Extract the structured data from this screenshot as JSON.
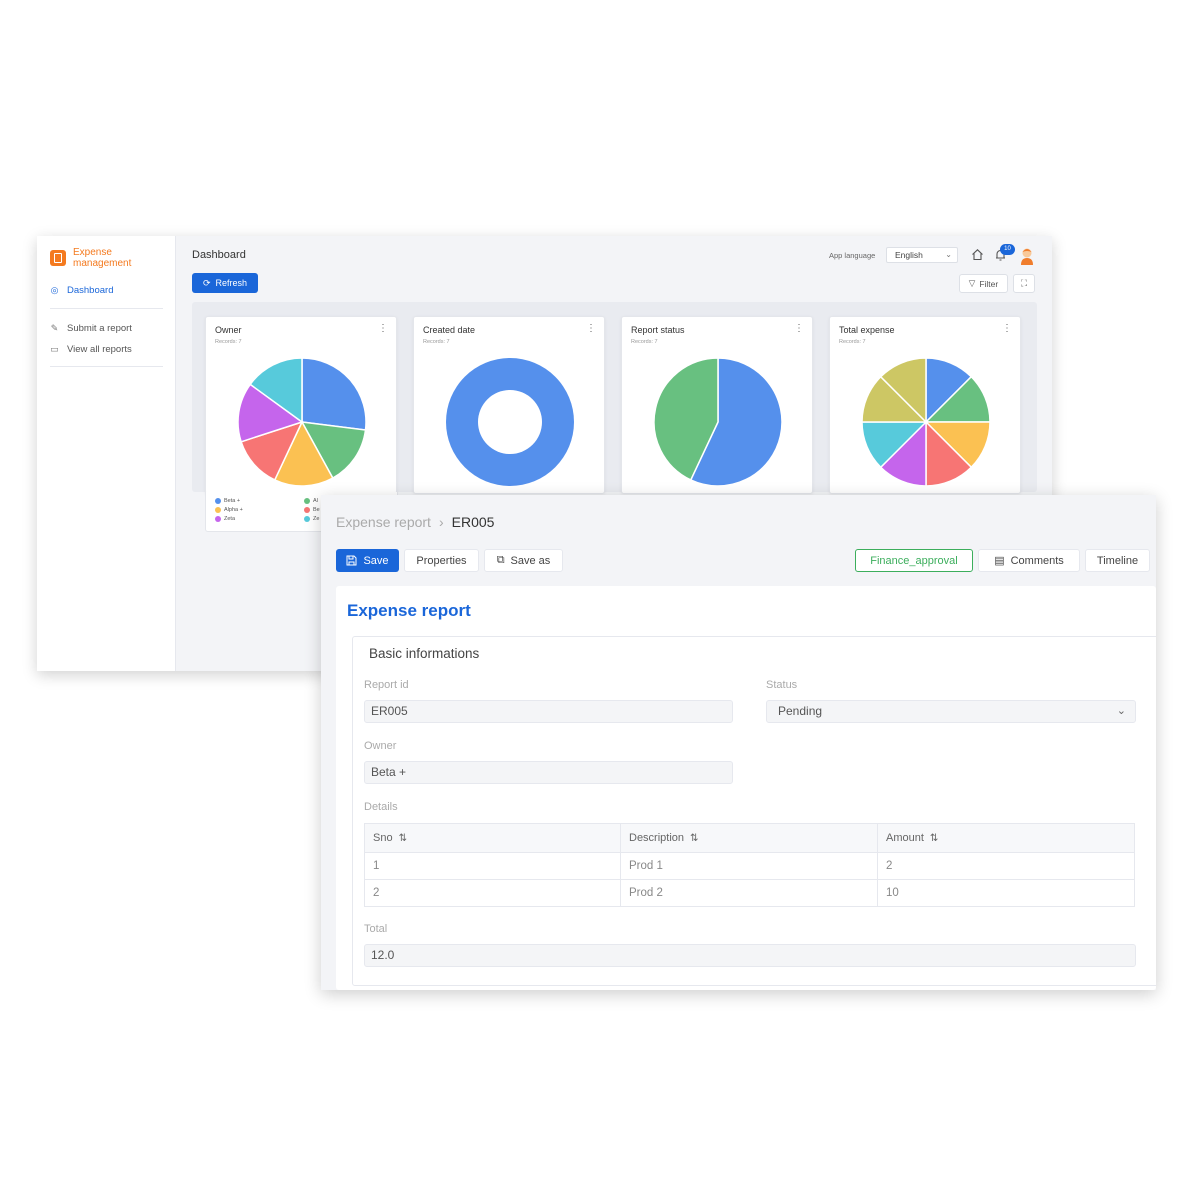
{
  "dashboard": {
    "app_name": "Expense management",
    "nav": [
      {
        "label": "Dashboard",
        "icon": "globe-icon",
        "active": true
      },
      {
        "label": "Submit a report",
        "icon": "pencil-icon"
      },
      {
        "label": "View all reports",
        "icon": "folder-icon"
      }
    ],
    "title": "Dashboard",
    "refresh_label": "Refresh",
    "app_language_label": "App language",
    "language_value": "English",
    "notification_count": "10",
    "filter_label": "Filter",
    "accent_color": "#1a66d9",
    "brand_color": "#f47a1f",
    "cards": [
      {
        "title": "Owner",
        "subtitle": "Records: 7"
      },
      {
        "title": "Created date",
        "subtitle": "Records: 7"
      },
      {
        "title": "Report status",
        "subtitle": "Records: 7"
      },
      {
        "title": "Total expense",
        "subtitle": "Records: 7"
      }
    ],
    "legend": [
      "Beta +",
      "Alpha +",
      "Zeta",
      "Al",
      "Be",
      "Ze"
    ]
  },
  "chart_data": [
    {
      "type": "pie",
      "title": "Owner",
      "values": [
        27,
        15,
        15,
        13,
        15,
        15
      ],
      "colors": [
        "#5590ec",
        "#68c080",
        "#fbc152",
        "#f77574",
        "#c565ec",
        "#57cadb"
      ]
    },
    {
      "type": "pie",
      "title": "Created date",
      "values": [
        100
      ],
      "colors": [
        "#5590ec"
      ]
    },
    {
      "type": "pie",
      "title": "Report status",
      "values": [
        57,
        43
      ],
      "colors": [
        "#5590ec",
        "#68c080"
      ]
    },
    {
      "type": "pie",
      "title": "Total expense",
      "values": [
        12.5,
        12.5,
        12.5,
        12.5,
        12.5,
        12.5,
        12.5,
        12.5
      ],
      "colors": [
        "#5590ec",
        "#68c080",
        "#fbc152",
        "#f77574",
        "#c565ec",
        "#57cadb",
        "#cdc764",
        "#cdc764"
      ]
    }
  ],
  "report": {
    "breadcrumb_parent": "Expense report",
    "breadcrumb_current": "ER005",
    "toolbar": {
      "save": "Save",
      "properties": "Properties",
      "save_as": "Save as",
      "finance": "Finance_approval",
      "comments": "Comments",
      "timeline": "Timeline"
    },
    "form_title": "Expense report",
    "section_title": "Basic informations",
    "report_id_label": "Report id",
    "report_id_value": "ER005",
    "status_label": "Status",
    "status_value": "Pending",
    "owner_label": "Owner",
    "owner_value": "Beta +",
    "details_label": "Details",
    "columns": [
      "Sno",
      "Description",
      "Amount"
    ],
    "rows": [
      [
        "1",
        "Prod 1",
        "2"
      ],
      [
        "2",
        "Prod 2",
        "10"
      ]
    ],
    "total_label": "Total",
    "total_value": "12.0"
  }
}
